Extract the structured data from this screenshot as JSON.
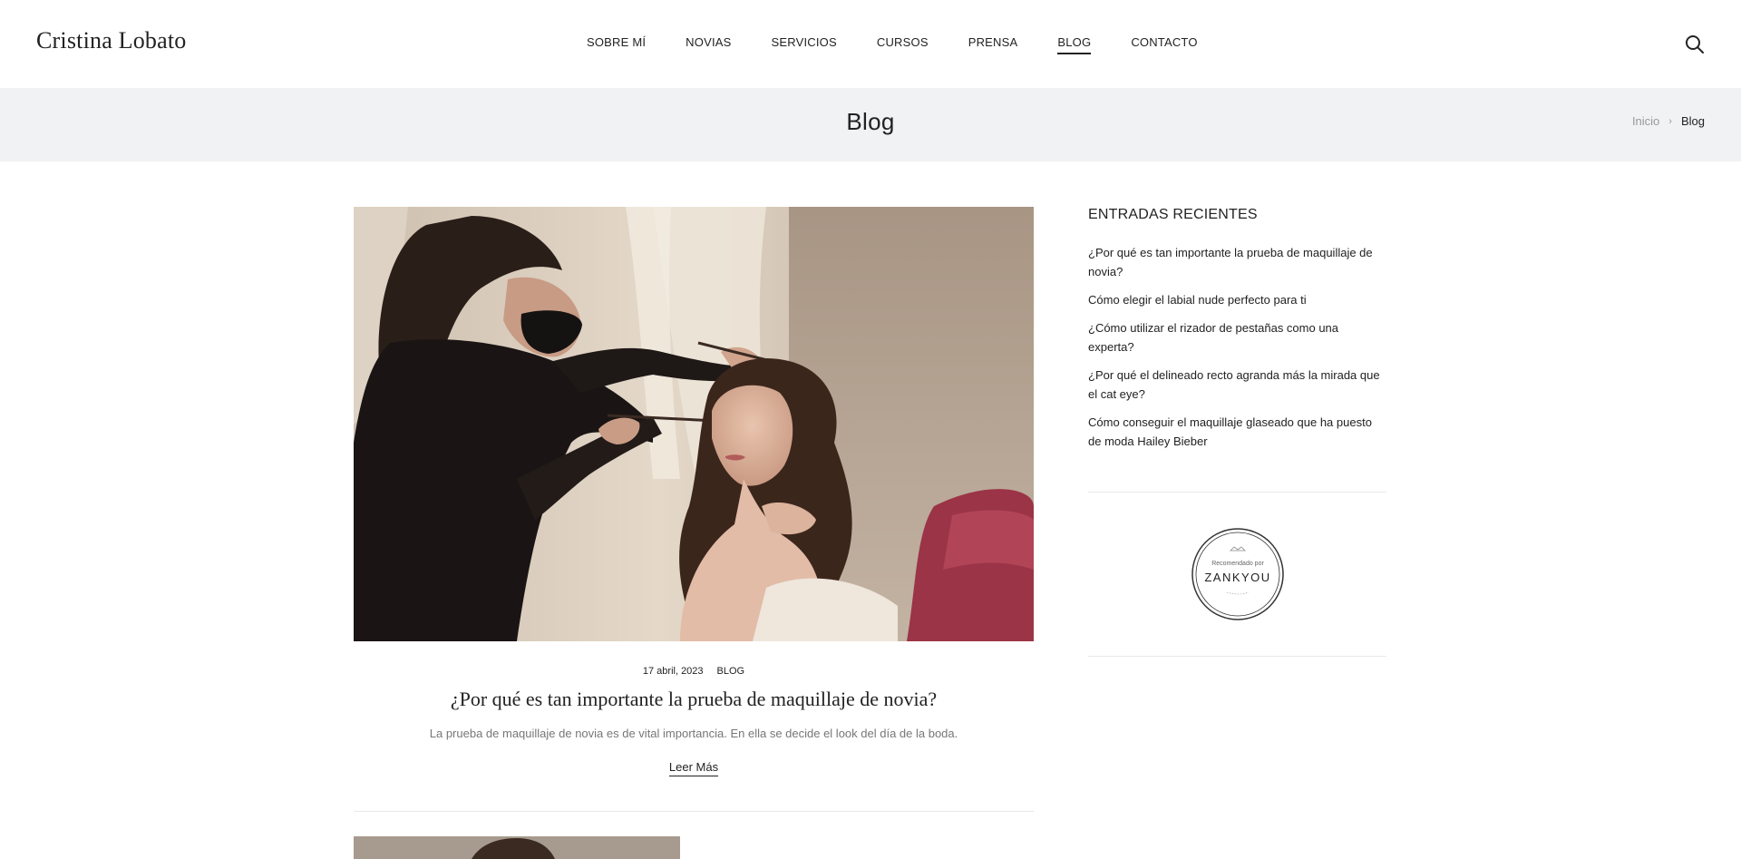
{
  "header": {
    "logo": "Cristina Lobato",
    "nav": [
      {
        "label": "SOBRE MÍ"
      },
      {
        "label": "NOVIAS"
      },
      {
        "label": "SERVICIOS"
      },
      {
        "label": "CURSOS"
      },
      {
        "label": "PRENSA"
      },
      {
        "label": "BLOG",
        "active": true
      },
      {
        "label": "CONTACTO"
      }
    ],
    "search_icon": "search-icon"
  },
  "title_band": {
    "title": "Blog",
    "breadcrumb": {
      "home": "Inicio",
      "separator": "›",
      "current": "Blog"
    }
  },
  "post": {
    "date": "17 abril, 2023",
    "category": "BLOG",
    "title": "¿Por qué es tan importante la prueba de maquillaje de novia?",
    "excerpt": "La prueba de maquillaje de novia es de vital importancia. En ella se decide el look del día de la boda.",
    "read_more": "Leer Más"
  },
  "sidebar": {
    "recent_title": "ENTRADAS RECIENTES",
    "recent_posts": [
      "¿Por qué es tan importante la prueba de maquillaje de novia?",
      "Cómo elegir el labial nude perfecto para ti",
      "¿Cómo utilizar el rizador de pestañas como una experta?",
      "¿Por qué el delineado recto agranda más la mirada que el cat eye?",
      "Cómo conseguir el maquillaje glaseado que ha puesto de moda Hailey Bieber"
    ],
    "badge": {
      "line1": "Recomendado por",
      "brand": "ZANKYOU"
    }
  },
  "colors": {
    "text": "#222222",
    "muted": "#777777",
    "band": "#f1f2f3",
    "divider": "#e9e9e9"
  }
}
